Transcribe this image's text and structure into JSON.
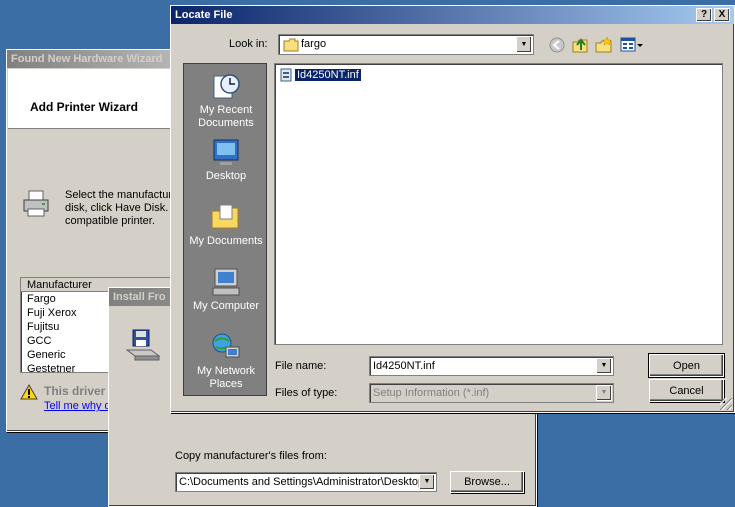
{
  "hardware_wizard": {
    "title": "Found New Hardware Wizard",
    "header": "Add Printer Wizard",
    "description": "Select the manufacturer and model of your printer. If your printer came with an installation disk, click Have Disk. If your printer is not listed, consult your printer documentation for a compatible printer.",
    "description_visible": "Select the manufactur\ndisk, click Have Disk.\ncompatible printer.",
    "list_header": "Manufacturer",
    "manufacturers": [
      "Fargo",
      "Fuji Xerox",
      "Fujitsu",
      "GCC",
      "Generic",
      "Gestetner"
    ],
    "warning": "This driver",
    "link": "Tell me why d"
  },
  "install_disk": {
    "title": "Install Fro",
    "copy_label": "Copy manufacturer's files from:",
    "path": "C:\\Documents and Settings\\Administrator\\Desktop",
    "browse": "Browse..."
  },
  "locate_file": {
    "title": "Locate File",
    "help": "?",
    "close": "X",
    "look_in_label": "Look in:",
    "look_in_value": "fargo",
    "places": {
      "recent": "My Recent Documents",
      "desktop": "Desktop",
      "documents": "My Documents",
      "computer": "My Computer",
      "network": "My Network Places"
    },
    "file": "Id4250NT.inf",
    "file_name_label": "File name:",
    "file_name_value": "Id4250NT.inf",
    "files_of_type_label": "Files of type:",
    "files_of_type_value": "Setup Information (*.inf)",
    "open": "Open",
    "cancel": "Cancel"
  }
}
